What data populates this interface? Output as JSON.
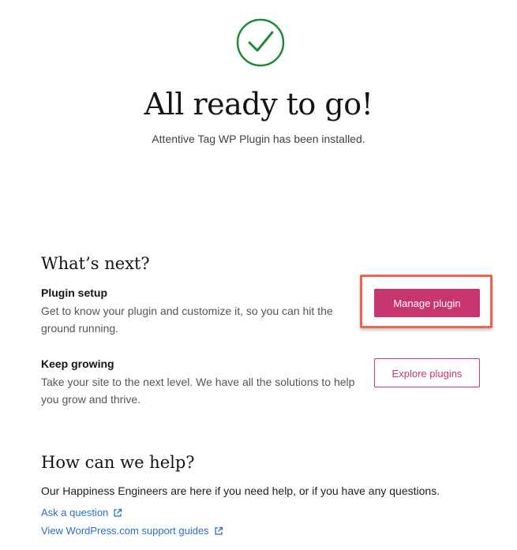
{
  "hero": {
    "icon": "checkmark-circle-icon",
    "title": "All ready to go!",
    "subtitle": "Attentive Tag WP Plugin has been installed."
  },
  "whats_next": {
    "heading": "What’s next?",
    "items": [
      {
        "title": "Plugin setup",
        "description": "Get to know your plugin and customize it, so you can hit the ground running.",
        "button_label": "Manage plugin"
      },
      {
        "title": "Keep growing",
        "description": "Take your site to the next level. We have all the solutions to help you grow and thrive.",
        "button_label": "Explore plugins"
      }
    ]
  },
  "help": {
    "heading": "How can we help?",
    "text": "Our Happiness Engineers are here if you need help, or if you have any questions.",
    "links": [
      {
        "label": "Ask a question",
        "icon": "external-link-icon"
      },
      {
        "label": "View WordPress.com support guides",
        "icon": "external-link-icon"
      }
    ]
  },
  "colors": {
    "accent": "#c9356e",
    "success": "#1f8a3a",
    "link": "#2c6fc0",
    "highlight": "#e8684f"
  }
}
